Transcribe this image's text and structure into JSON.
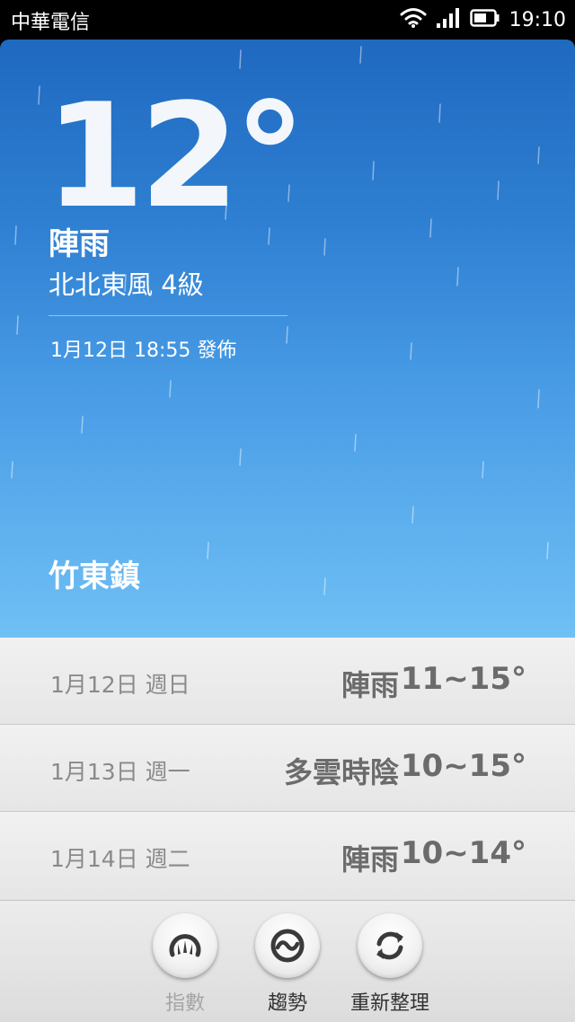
{
  "status_bar": {
    "carrier": "中華電信",
    "time": "19:10",
    "icons": [
      "wifi-icon",
      "signal-icon",
      "battery-icon"
    ]
  },
  "current": {
    "temperature": "12°",
    "condition": "陣雨",
    "wind": "北北東風 4級",
    "published": "1月12日 18:55 發佈",
    "location": "竹東鎮"
  },
  "forecast": [
    {
      "date": "1月12日 週日",
      "condition": "陣雨",
      "range": "11~15°"
    },
    {
      "date": "1月13日 週一",
      "condition": "多雲時陰",
      "range": "10~15°"
    },
    {
      "date": "1月14日 週二",
      "condition": "陣雨",
      "range": "10~14°"
    }
  ],
  "actions": [
    {
      "label": "指數",
      "icon": "gauge-icon",
      "enabled": false
    },
    {
      "label": "趨勢",
      "icon": "trend-icon",
      "enabled": true
    },
    {
      "label": "重新整理",
      "icon": "refresh-icon",
      "enabled": true
    }
  ],
  "colors": {
    "sky_top": "#1f69c0",
    "sky_bottom": "#6fc0f5",
    "icon_dark": "#3a3a3a"
  }
}
